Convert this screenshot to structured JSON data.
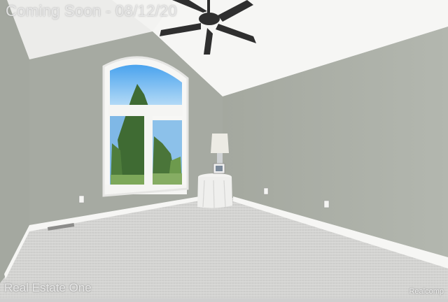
{
  "watermark": {
    "status_text": "Coming Soon - 08/1",
    "date_fragment": "2/20",
    "brand": "Real Estate One",
    "site": "Realcomp"
  },
  "colors": {
    "ceiling": "#f4f4f2",
    "wall_left": "#a8aca4",
    "wall_back": "#a9ada5",
    "wall_right": "#aeb2aa",
    "carpet": "#d3d3d1",
    "trim": "#f7f7f5",
    "fan": "#2f2f2f"
  }
}
